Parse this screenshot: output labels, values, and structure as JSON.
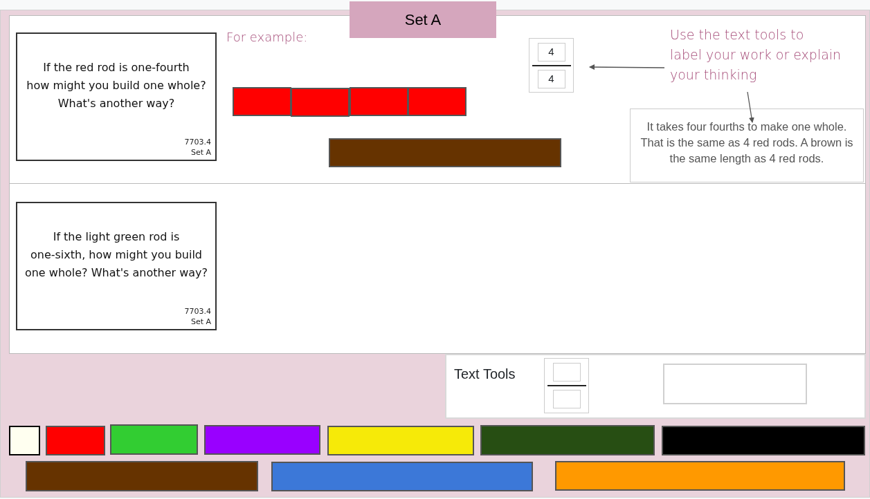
{
  "title": "Set A",
  "example_label": "For example:",
  "cards": [
    {
      "prompt": "If the red rod is one-fourth\nhow might you build one whole?\nWhat's another way?",
      "code": "7703.4",
      "set": "Set A"
    },
    {
      "prompt": "If the light green rod is\none-sixth, how might you build\none whole? What's another way?",
      "code": "7703.4",
      "set": "Set A"
    }
  ],
  "example_rods": [
    {
      "color": "#ff0000"
    },
    {
      "color": "#ff0000"
    },
    {
      "color": "#ff0000"
    },
    {
      "color": "#ff0000"
    },
    {
      "color": "#663300"
    }
  ],
  "fraction": {
    "numerator": "4",
    "denominator": "4"
  },
  "hint": "Use the text tools to\nlabel your work or explain\nyour thinking",
  "answer": "It takes four fourths to make one whole. That is the same as 4 red rods. A brown is the same length as 4 red rods.",
  "text_tools": {
    "label": "Text Tools"
  },
  "palette": [
    {
      "color": "#fffff0"
    },
    {
      "color": "#ff0000"
    },
    {
      "color": "#32cd32"
    },
    {
      "color": "#9900ff"
    },
    {
      "color": "#f6ea08"
    },
    {
      "color": "#274e13"
    },
    {
      "color": "#000000"
    },
    {
      "color": "#663300"
    },
    {
      "color": "#3c78d8"
    },
    {
      "color": "#ff9900"
    }
  ]
}
